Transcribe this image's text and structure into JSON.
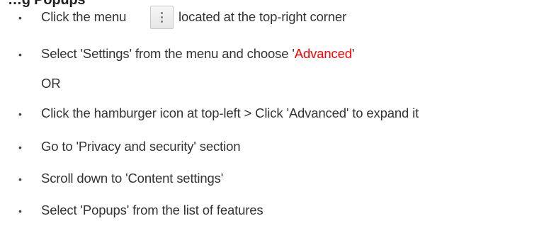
{
  "heading": "…g Popups",
  "menu_icon": "vertical-ellipsis-icon",
  "steps": [
    {
      "bullet": "•",
      "before": "Click the menu",
      "after": "located at the top-right corner"
    },
    {
      "bullet": "•",
      "before": "Select 'Settings' from the menu and choose '",
      "highlight": "Advanced",
      "after": "'"
    },
    {
      "text": "OR"
    },
    {
      "bullet": "•",
      "text": "Click the hamburger icon at top-left > Click 'Advanced' to expand it"
    },
    {
      "bullet": "•",
      "text": "Go to 'Privacy and security' section"
    },
    {
      "bullet": "•",
      "text": "Scroll down to 'Content settings'"
    },
    {
      "bullet": "•",
      "text": "Select 'Popups' from the list of features"
    }
  ],
  "colors": {
    "highlight": "#ff0000",
    "text": "#333333"
  }
}
